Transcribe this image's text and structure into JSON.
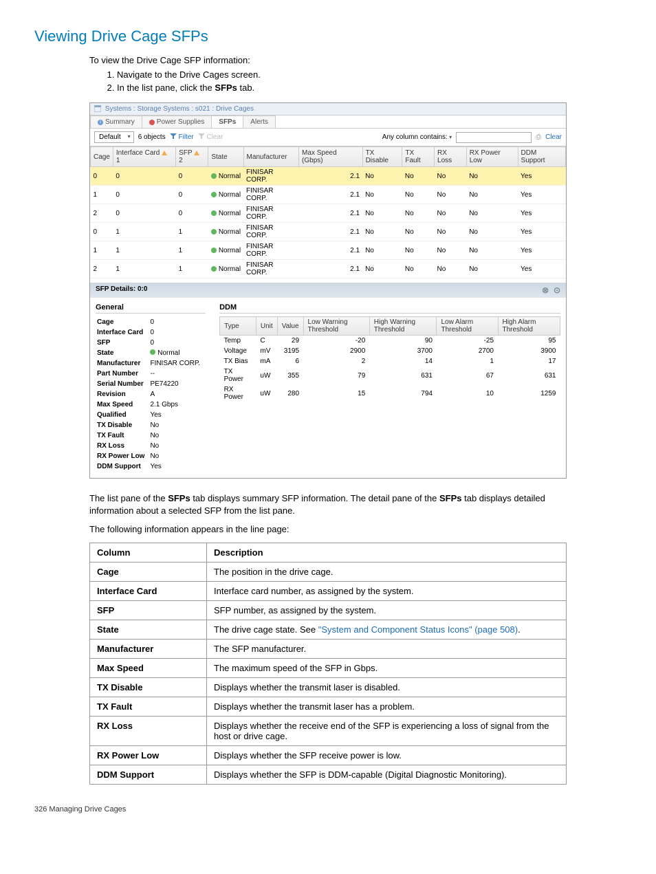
{
  "page": {
    "heading": "Viewing Drive Cage SFPs",
    "intro": "To view the Drive Cage SFP information:",
    "steps": [
      "Navigate to the Drive Cages screen.",
      "In the list pane, click the SFPs tab."
    ],
    "steps_bold_word": "SFPs",
    "after_shot_1a": "The list pane of the ",
    "after_shot_1b": " tab displays summary SFP information. The detail pane of the ",
    "after_shot_1c": " tab displays detailed information about a selected SFP from the list pane.",
    "after_shot_2": "The following information appears in the line page:",
    "footer": "326   Managing Drive Cages"
  },
  "screenshot": {
    "breadcrumb": "Systems : Storage Systems : s021 : Drive Cages",
    "tabs": [
      "Summary",
      "Power Supplies",
      "SFPs",
      "Alerts"
    ],
    "active_tab": "SFPs",
    "filter": {
      "default": "Default",
      "count": "6 objects",
      "filter_label": "Filter",
      "clear_label": "Clear",
      "any_col": "Any column contains:",
      "right_clear": "Clear"
    },
    "columns": [
      "Cage",
      "Interface Card",
      "SFP",
      "State",
      "Manufacturer",
      "Max Speed (Gbps)",
      "TX Disable",
      "TX Fault",
      "RX Loss",
      "RX Power Low",
      "DDM Support"
    ],
    "sort_icons": {
      "col1": "▲ 1",
      "col2": "▲ 2"
    },
    "rows": [
      {
        "cage": "0",
        "ic": "0",
        "sfp": "0",
        "state": "Normal",
        "mfr": "FINISAR CORP.",
        "spd": "2.1",
        "txd": "No",
        "txf": "No",
        "rxl": "No",
        "rxp": "No",
        "ddm": "Yes",
        "selected": true
      },
      {
        "cage": "1",
        "ic": "0",
        "sfp": "0",
        "state": "Normal",
        "mfr": "FINISAR CORP.",
        "spd": "2.1",
        "txd": "No",
        "txf": "No",
        "rxl": "No",
        "rxp": "No",
        "ddm": "Yes"
      },
      {
        "cage": "2",
        "ic": "0",
        "sfp": "0",
        "state": "Normal",
        "mfr": "FINISAR CORP.",
        "spd": "2.1",
        "txd": "No",
        "txf": "No",
        "rxl": "No",
        "rxp": "No",
        "ddm": "Yes"
      },
      {
        "cage": "0",
        "ic": "1",
        "sfp": "1",
        "state": "Normal",
        "mfr": "FINISAR CORP.",
        "spd": "2.1",
        "txd": "No",
        "txf": "No",
        "rxl": "No",
        "rxp": "No",
        "ddm": "Yes"
      },
      {
        "cage": "1",
        "ic": "1",
        "sfp": "1",
        "state": "Normal",
        "mfr": "FINISAR CORP.",
        "spd": "2.1",
        "txd": "No",
        "txf": "No",
        "rxl": "No",
        "rxp": "No",
        "ddm": "Yes"
      },
      {
        "cage": "2",
        "ic": "1",
        "sfp": "1",
        "state": "Normal",
        "mfr": "FINISAR CORP.",
        "spd": "2.1",
        "txd": "No",
        "txf": "No",
        "rxl": "No",
        "rxp": "No",
        "ddm": "Yes"
      }
    ],
    "details": {
      "title": "SFP Details: 0:0",
      "general_title": "General",
      "ddm_title": "DDM",
      "general": [
        [
          "Cage",
          "0"
        ],
        [
          "Interface Card",
          "0"
        ],
        [
          "SFP",
          "0"
        ],
        [
          "State",
          "Normal"
        ],
        [
          "Manufacturer",
          "FINISAR CORP."
        ],
        [
          "Part Number",
          "--"
        ],
        [
          "Serial Number",
          "PE74220"
        ],
        [
          "Revision",
          "A"
        ],
        [
          "Max Speed",
          "2.1 Gbps"
        ],
        [
          "Qualified",
          "Yes"
        ],
        [
          "TX Disable",
          "No"
        ],
        [
          "TX Fault",
          "No"
        ],
        [
          "RX Loss",
          "No"
        ],
        [
          "RX Power Low",
          "No"
        ],
        [
          "DDM Support",
          "Yes"
        ]
      ],
      "ddm_columns": [
        "Type",
        "Unit",
        "Value",
        "Low Warning Threshold",
        "High Warning Threshold",
        "Low Alarm Threshold",
        "High Alarm Threshold"
      ],
      "ddm_rows": [
        [
          "Temp",
          "C",
          "29",
          "-20",
          "90",
          "-25",
          "95"
        ],
        [
          "Voltage",
          "mV",
          "3195",
          "2900",
          "3700",
          "2700",
          "3900"
        ],
        [
          "TX Bias",
          "mA",
          "6",
          "2",
          "14",
          "1",
          "17"
        ],
        [
          "TX Power",
          "uW",
          "355",
          "79",
          "631",
          "67",
          "631"
        ],
        [
          "RX Power",
          "uW",
          "280",
          "15",
          "794",
          "10",
          "1259"
        ]
      ]
    }
  },
  "col_table": {
    "headers": [
      "Column",
      "Description"
    ],
    "rows": [
      {
        "c": "Cage",
        "d": "The position in the drive cage."
      },
      {
        "c": "Interface Card",
        "d": "Interface card number, as assigned by the system."
      },
      {
        "c": "SFP",
        "d": "SFP number, as assigned by the system."
      },
      {
        "c": "State",
        "d_pre": "The drive cage state. See ",
        "link": "\"System and Component Status Icons\" (page 508)",
        "d_post": "."
      },
      {
        "c": "Manufacturer",
        "d": "The SFP manufacturer."
      },
      {
        "c": "Max Speed",
        "d": "The maximum speed of the SFP in Gbps."
      },
      {
        "c": "TX Disable",
        "d": "Displays whether the transmit laser is disabled."
      },
      {
        "c": "TX Fault",
        "d": "Displays whether the transmit laser has a problem."
      },
      {
        "c": "RX Loss",
        "d": "Displays whether the receive end of the SFP is experiencing a loss of signal from the host or drive cage."
      },
      {
        "c": "RX Power Low",
        "d": "Displays whether the SFP receive power is low."
      },
      {
        "c": "DDM Support",
        "d": "Displays whether the SFP is DDM-capable (Digital Diagnostic Monitoring)."
      }
    ]
  }
}
